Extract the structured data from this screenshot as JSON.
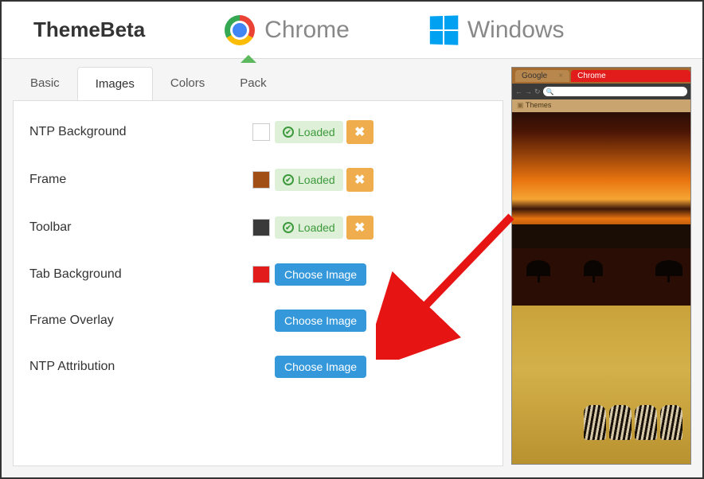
{
  "header": {
    "brand": "ThemeBeta",
    "nav": [
      {
        "label": "Chrome",
        "active": true
      },
      {
        "label": "Windows",
        "active": false
      }
    ]
  },
  "tabs": [
    "Basic",
    "Images",
    "Colors",
    "Pack"
  ],
  "active_tab": "Images",
  "rows": [
    {
      "label": "NTP Background",
      "swatch": "#ffffff",
      "loaded": true,
      "status_text": "Loaded"
    },
    {
      "label": "Frame",
      "swatch": "#a24f16",
      "loaded": true,
      "status_text": "Loaded"
    },
    {
      "label": "Toolbar",
      "swatch": "#3a3a3a",
      "loaded": true,
      "status_text": "Loaded"
    },
    {
      "label": "Tab Background",
      "swatch": "#e21b1b",
      "loaded": false,
      "choose_text": "Choose Image"
    },
    {
      "label": "Frame Overlay",
      "swatch": null,
      "loaded": false,
      "choose_text": "Choose Image"
    },
    {
      "label": "NTP Attribution",
      "swatch": null,
      "loaded": false,
      "choose_text": "Choose Image"
    }
  ],
  "preview": {
    "tab1": "Google",
    "tab2": "Chrome",
    "bookmark": "Themes"
  },
  "colors": {
    "loaded_bg": "#dff0d8",
    "loaded_fg": "#3c9a3c",
    "remove_btn": "#f0ad4e",
    "choose_btn": "#3498db",
    "arrow": "#e71414"
  }
}
